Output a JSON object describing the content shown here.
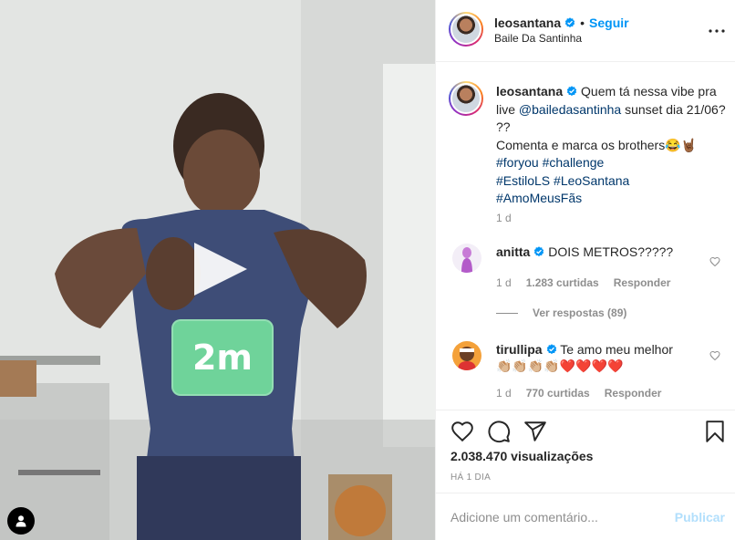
{
  "media": {
    "sticker_text": "2m",
    "icons": {
      "play": "play-icon",
      "tag": "user-tag-icon"
    }
  },
  "header": {
    "username": "leosantana",
    "separator": "•",
    "follow_label": "Seguir",
    "location": "Baile Da Santinha",
    "icons": {
      "verified": "verified-badge-icon",
      "more": "more-options-icon"
    }
  },
  "caption": {
    "username": "leosantana",
    "text_1": " Quem tá nessa vibe pra live ",
    "mention": "@bailedasantinha",
    "text_2": " sunset dia 21/06? ??",
    "line_3": "Comenta e marca os brothers😂🤘🏾",
    "hashtags_line_1": "#foryou #challenge",
    "hashtags_line_2": "#EstiloLS #LeoSantana",
    "hashtags_line_3": "#AmoMeusFãs",
    "time": "1 d"
  },
  "comments": [
    {
      "username": "anitta",
      "text": " DOIS METROS?????",
      "time": "1 d",
      "likes": "1.283 curtidas",
      "reply_label": "Responder"
    },
    {
      "username": "tirullipa",
      "text": " Te amo meu melhor",
      "text_line_2": "👏🏼👏🏼👏🏼👏🏼❤️❤️❤️❤️",
      "time": "1 d",
      "likes": "770 curtidas",
      "reply_label": "Responder"
    }
  ],
  "view_replies_label": "Ver respostas (89)",
  "actions": {
    "icons": {
      "like": "heart-icon",
      "comment": "comment-icon",
      "share": "share-icon",
      "save": "bookmark-icon"
    }
  },
  "views": "2.038.470 visualizações",
  "posted_ago": "há 1 dia",
  "add_comment": {
    "placeholder": "Adicione um comentário...",
    "publish_label": "Publicar"
  },
  "colors": {
    "accent": "#0095f6",
    "publish_disabled": "#b2dffc",
    "muted": "#8e8e8e",
    "text": "#262626",
    "link": "#00376b",
    "sticker": "#6fd39a"
  }
}
